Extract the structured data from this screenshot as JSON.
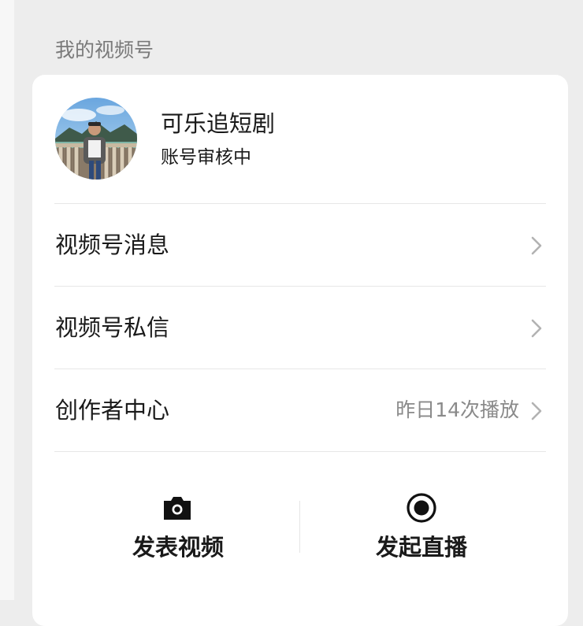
{
  "section": {
    "title": "我的视频号"
  },
  "profile": {
    "name": "可乐追短剧",
    "status": "账号审核中",
    "avatar_icon": "avatar-photo"
  },
  "menu": {
    "items": [
      {
        "label": "视频号消息",
        "value": "",
        "icon": "chevron-right-icon"
      },
      {
        "label": "视频号私信",
        "value": "",
        "icon": "chevron-right-icon"
      },
      {
        "label": "创作者中心",
        "value": "昨日14次播放",
        "icon": "chevron-right-icon"
      }
    ]
  },
  "actions": {
    "post_video": {
      "label": "发表视频",
      "icon": "camera-icon"
    },
    "go_live": {
      "label": "发起直播",
      "icon": "record-icon"
    }
  },
  "colors": {
    "page_bg": "#ededed",
    "card_bg": "#ffffff",
    "primary_text": "#1a1a1a",
    "secondary_text": "#7a7a7a",
    "divider": "#e7e7e7"
  }
}
